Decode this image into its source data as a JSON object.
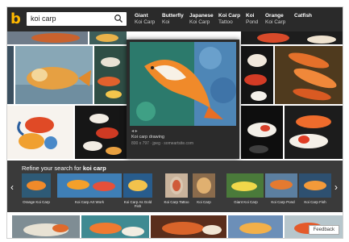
{
  "search": {
    "query": "koi carp"
  },
  "header": {
    "related": [
      {
        "title": "Giant",
        "sub": "Koi Carp"
      },
      {
        "title": "Butterfly",
        "sub": "Koi"
      },
      {
        "title": "Japanese",
        "sub": "Koi Carp"
      },
      {
        "title": "Koi Carp",
        "sub": "Tattoo"
      },
      {
        "title": "Koi",
        "sub": "Pond"
      },
      {
        "title": "Orange",
        "sub": "Koi Carp"
      },
      {
        "title": "Catfish",
        "sub": ""
      }
    ]
  },
  "preview": {
    "title": "Koi carp drawing",
    "meta": "800 x 797 · jpeg · someartsite.com"
  },
  "related_section": {
    "prefix": "Refine your search for",
    "query": "koi carp",
    "items": [
      "Orange Koi Carp",
      "Koi Carp Art Work",
      "Koi Carp As Gold Fish",
      "Koi Carp Tattoo",
      "Koi Carp",
      "Giant Koi Carp",
      "Koi Carp Pond",
      "Koi Carp Fish"
    ]
  },
  "feedback": "Feedback"
}
